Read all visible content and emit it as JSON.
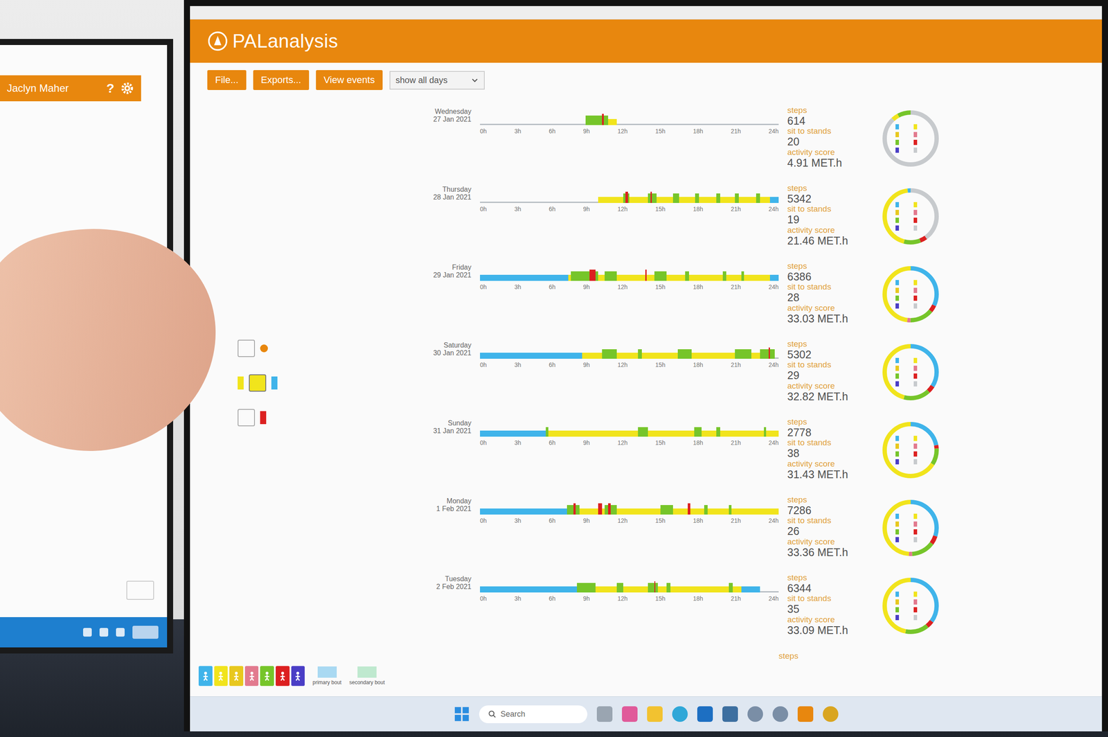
{
  "left_window": {
    "user": "Jaclyn Maher",
    "help": "?"
  },
  "app": {
    "name": "PALanalysis"
  },
  "toolbar": {
    "buttons": [
      "File...",
      "Exports...",
      "View events"
    ],
    "dropdown": "show all days"
  },
  "axis_ticks": [
    "0h",
    "3h",
    "6h",
    "9h",
    "12h",
    "15h",
    "18h",
    "21h",
    "24h"
  ],
  "stat_labels": {
    "steps": "steps",
    "sit": "sit to stands",
    "score": "activity score"
  },
  "activity_kinds": [
    {
      "kind": "lying",
      "color": "#3fb4ea",
      "legend": true
    },
    {
      "kind": "sitting",
      "color": "#f1e41c",
      "legend": true
    },
    {
      "kind": "seated",
      "color": "#e8c81e",
      "legend": true
    },
    {
      "kind": "vehicle",
      "color": "#e27a8e",
      "legend": true
    },
    {
      "kind": "standing",
      "color": "#76c52a",
      "legend": true
    },
    {
      "kind": "stepping",
      "color": "#dc2020",
      "legend": true
    },
    {
      "kind": "cycling",
      "color": "#4a3ec6",
      "legend": true
    },
    {
      "kind": "none",
      "color": "#c7cacd",
      "legend": false
    }
  ],
  "bout_swatches": [
    {
      "label": "primary bout",
      "color": "#a9d9f2"
    },
    {
      "label": "secondary bout",
      "color": "#bfe9cf"
    }
  ],
  "days": [
    {
      "day": "Wednesday",
      "date": "27 Jan 2021",
      "steps": "614",
      "sit_to_stands": "20",
      "score": "4.91 MET.h",
      "segments": [
        {
          "kind": "sitting",
          "from": 10.3,
          "to": 11
        },
        {
          "kind": "standing",
          "from": 8.5,
          "to": 10.3
        },
        {
          "kind": "stepping",
          "from": 9.8,
          "to": 9.95
        }
      ],
      "ring": [
        {
          "kind": "none",
          "share": 0.88
        },
        {
          "kind": "sitting",
          "share": 0.04
        },
        {
          "kind": "standing",
          "share": 0.08
        }
      ]
    },
    {
      "day": "Thursday",
      "date": "28 Jan 2021",
      "steps": "5342",
      "sit_to_stands": "19",
      "score": "21.46 MET.h",
      "segments": [
        {
          "kind": "sitting",
          "from": 9.5,
          "to": 23.3
        },
        {
          "kind": "lying",
          "from": 23.3,
          "to": 24
        },
        {
          "kind": "standing",
          "from": 11.5,
          "to": 12
        },
        {
          "kind": "standing",
          "from": 13.5,
          "to": 14.2
        },
        {
          "kind": "standing",
          "from": 15.5,
          "to": 16
        },
        {
          "kind": "standing",
          "from": 17.3,
          "to": 17.6
        },
        {
          "kind": "standing",
          "from": 19,
          "to": 19.3
        },
        {
          "kind": "standing",
          "from": 20.5,
          "to": 20.8
        },
        {
          "kind": "standing",
          "from": 22.2,
          "to": 22.5
        },
        {
          "kind": "stepping",
          "from": 11.7,
          "to": 11.9
        },
        {
          "kind": "stepping",
          "from": 13.7,
          "to": 13.8
        }
      ],
      "ring": [
        {
          "kind": "none",
          "share": 0.4
        },
        {
          "kind": "stepping",
          "share": 0.04
        },
        {
          "kind": "standing",
          "share": 0.1
        },
        {
          "kind": "sitting",
          "share": 0.44
        },
        {
          "kind": "lying",
          "share": 0.02
        }
      ]
    },
    {
      "day": "Friday",
      "date": "29 Jan 2021",
      "steps": "6386",
      "sit_to_stands": "28",
      "score": "33.03 MET.h",
      "segments": [
        {
          "kind": "lying",
          "from": 0,
          "to": 7.1
        },
        {
          "kind": "sitting",
          "from": 7.1,
          "to": 23.3
        },
        {
          "kind": "lying",
          "from": 23.3,
          "to": 24
        },
        {
          "kind": "standing",
          "from": 7.3,
          "to": 9.5
        },
        {
          "kind": "standing",
          "from": 10,
          "to": 11
        },
        {
          "kind": "standing",
          "from": 14,
          "to": 15
        },
        {
          "kind": "standing",
          "from": 16.5,
          "to": 16.8
        },
        {
          "kind": "standing",
          "from": 19.5,
          "to": 19.8
        },
        {
          "kind": "standing",
          "from": 21,
          "to": 21.2
        },
        {
          "kind": "stepping",
          "from": 8.8,
          "to": 9.3
        },
        {
          "kind": "stepping",
          "from": 13.3,
          "to": 13.4
        }
      ],
      "ring": [
        {
          "kind": "lying",
          "share": 0.32
        },
        {
          "kind": "stepping",
          "share": 0.04
        },
        {
          "kind": "standing",
          "share": 0.14
        },
        {
          "kind": "vehicle",
          "share": 0.02
        },
        {
          "kind": "sitting",
          "share": 0.48
        }
      ]
    },
    {
      "day": "Saturday",
      "date": "30 Jan 2021",
      "steps": "5302",
      "sit_to_stands": "29",
      "score": "32.82 MET.h",
      "segments": [
        {
          "kind": "lying",
          "from": 0,
          "to": 8.2
        },
        {
          "kind": "sitting",
          "from": 8.2,
          "to": 23.7
        },
        {
          "kind": "standing",
          "from": 9.8,
          "to": 11
        },
        {
          "kind": "standing",
          "from": 12.7,
          "to": 13
        },
        {
          "kind": "standing",
          "from": 15.9,
          "to": 17
        },
        {
          "kind": "standing",
          "from": 20.5,
          "to": 21.8
        },
        {
          "kind": "standing",
          "from": 22.5,
          "to": 23.7
        },
        {
          "kind": "stepping",
          "from": 23.2,
          "to": 23.3
        }
      ],
      "ring": [
        {
          "kind": "lying",
          "share": 0.34
        },
        {
          "kind": "stepping",
          "share": 0.04
        },
        {
          "kind": "standing",
          "share": 0.16
        },
        {
          "kind": "sitting",
          "share": 0.46
        }
      ]
    },
    {
      "day": "Sunday",
      "date": "31 Jan 2021",
      "steps": "2778",
      "sit_to_stands": "38",
      "score": "31.43 MET.h",
      "segments": [
        {
          "kind": "lying",
          "from": 0,
          "to": 5.3
        },
        {
          "kind": "sitting",
          "from": 5.3,
          "to": 24
        },
        {
          "kind": "standing",
          "from": 5.3,
          "to": 5.5
        },
        {
          "kind": "standing",
          "from": 12.7,
          "to": 13.5
        },
        {
          "kind": "standing",
          "from": 17.2,
          "to": 17.8
        },
        {
          "kind": "standing",
          "from": 19,
          "to": 19.3
        },
        {
          "kind": "standing",
          "from": 22.8,
          "to": 23
        }
      ],
      "ring": [
        {
          "kind": "lying",
          "share": 0.22
        },
        {
          "kind": "stepping",
          "share": 0.02
        },
        {
          "kind": "standing",
          "share": 0.1
        },
        {
          "kind": "sitting",
          "share": 0.66
        }
      ]
    },
    {
      "day": "Monday",
      "date": "1 Feb 2021",
      "steps": "7286",
      "sit_to_stands": "26",
      "score": "33.36 MET.h",
      "segments": [
        {
          "kind": "lying",
          "from": 0,
          "to": 7
        },
        {
          "kind": "sitting",
          "from": 7,
          "to": 24
        },
        {
          "kind": "standing",
          "from": 7,
          "to": 8
        },
        {
          "kind": "standing",
          "from": 10,
          "to": 11
        },
        {
          "kind": "standing",
          "from": 14.5,
          "to": 15.5
        },
        {
          "kind": "standing",
          "from": 18,
          "to": 18.3
        },
        {
          "kind": "standing",
          "from": 20,
          "to": 20.2
        },
        {
          "kind": "stepping",
          "from": 7.5,
          "to": 7.7
        },
        {
          "kind": "stepping",
          "from": 9.5,
          "to": 9.8
        },
        {
          "kind": "stepping",
          "from": 10.3,
          "to": 10.5
        },
        {
          "kind": "stepping",
          "from": 16.7,
          "to": 16.9
        }
      ],
      "ring": [
        {
          "kind": "lying",
          "share": 0.3
        },
        {
          "kind": "stepping",
          "share": 0.05
        },
        {
          "kind": "standing",
          "share": 0.14
        },
        {
          "kind": "vehicle",
          "share": 0.02
        },
        {
          "kind": "sitting",
          "share": 0.49
        }
      ]
    },
    {
      "day": "Tuesday",
      "date": "2 Feb 2021",
      "steps": "6344",
      "sit_to_stands": "35",
      "score": "33.09 MET.h",
      "segments": [
        {
          "kind": "lying",
          "from": 0,
          "to": 7.8
        },
        {
          "kind": "sitting",
          "from": 7.8,
          "to": 21
        },
        {
          "kind": "lying",
          "from": 21,
          "to": 22.5
        },
        {
          "kind": "standing",
          "from": 7.8,
          "to": 9.3
        },
        {
          "kind": "standing",
          "from": 11,
          "to": 11.5
        },
        {
          "kind": "standing",
          "from": 13.5,
          "to": 14.3
        },
        {
          "kind": "standing",
          "from": 15,
          "to": 15.3
        },
        {
          "kind": "standing",
          "from": 20,
          "to": 20.3
        },
        {
          "kind": "stepping",
          "from": 14,
          "to": 14.1
        }
      ],
      "ring": [
        {
          "kind": "lying",
          "share": 0.35
        },
        {
          "kind": "stepping",
          "share": 0.04
        },
        {
          "kind": "standing",
          "share": 0.14
        },
        {
          "kind": "sitting",
          "share": 0.47
        }
      ]
    }
  ],
  "next_row_label": "steps",
  "taskbar": {
    "search_placeholder": "Search"
  }
}
